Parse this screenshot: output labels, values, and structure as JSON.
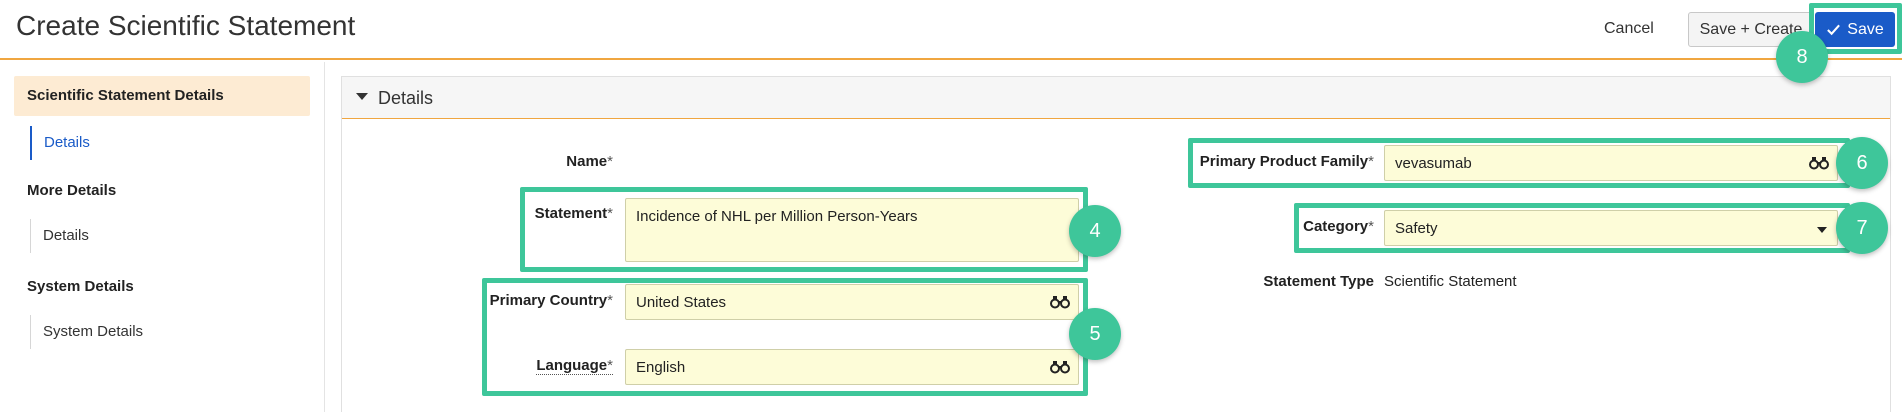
{
  "header": {
    "title": "Create Scientific Statement",
    "cancel_label": "Cancel",
    "save_create_label": "Save + Create",
    "save_label": "Save"
  },
  "sidebar": {
    "sections": [
      {
        "label": "Scientific Statement Details",
        "items": [
          "Details"
        ]
      },
      {
        "label": "More Details",
        "items": [
          "Details"
        ]
      },
      {
        "label": "System Details",
        "items": [
          "System Details"
        ]
      }
    ]
  },
  "panel": {
    "title": "Details"
  },
  "fields": {
    "name": {
      "label": "Name",
      "required": "*",
      "value": ""
    },
    "statement": {
      "label": "Statement",
      "required": "*",
      "value": "Incidence of NHL per Million Person-Years"
    },
    "primary_country": {
      "label": "Primary Country",
      "required": "*",
      "value": "United States"
    },
    "language": {
      "label": "Language",
      "required": "*",
      "value": "English"
    },
    "primary_product_family": {
      "label": "Primary Product Family",
      "required": "*",
      "value": "vevasumab"
    },
    "category": {
      "label": "Category",
      "required": "*",
      "value": "Safety"
    },
    "statement_type": {
      "label": "Statement Type",
      "value": "Scientific Statement"
    }
  },
  "annotations": [
    "4",
    "5",
    "6",
    "7",
    "8"
  ],
  "colors": {
    "accent_orange": "#f0a640",
    "primary_blue": "#1a5bc8",
    "highlight_green": "#3ec69a",
    "input_yellow": "#fdfcd8"
  }
}
